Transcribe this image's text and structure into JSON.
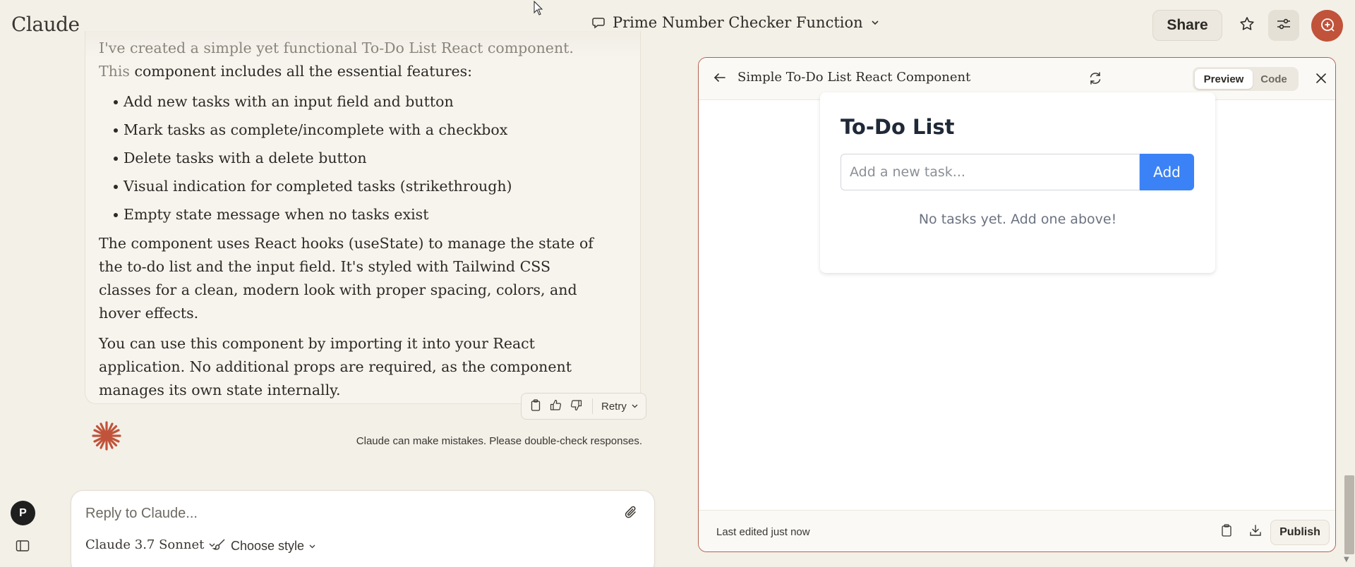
{
  "app": {
    "logo": "Claude"
  },
  "header": {
    "conversation_title": "Prime Number Checker Function",
    "share_label": "Share"
  },
  "message": {
    "intro_faded": "I've created a simple yet functional To-Do List React component. This",
    "intro_rest": "component includes all the essential features:",
    "features": [
      "Add new tasks with an input field and button",
      "Mark tasks as complete/incomplete with a checkbox",
      "Delete tasks with a delete button",
      "Visual indication for completed tasks (strikethrough)",
      "Empty state message when no tasks exist"
    ],
    "paragraph_2": "The component uses React hooks (useState) to manage the state of the to-do list and the input field. It's styled with Tailwind CSS classes for a clean, modern look with proper spacing, colors, and hover effects.",
    "paragraph_3": "You can use this component by importing it into your React application. No additional props are required, as the component manages its own state internally.",
    "retry_label": "Retry"
  },
  "disclaimer": "Claude can make mistakes. Please double-check responses.",
  "composer": {
    "placeholder": "Reply to Claude...",
    "model": "Claude 3.7 Sonnet",
    "style": "Choose style"
  },
  "user": {
    "initial": "P"
  },
  "artifact": {
    "title": "Simple To-Do List React Component",
    "tabs": {
      "preview": "Preview",
      "code": "Code",
      "active": "Preview"
    },
    "preview": {
      "heading": "To-Do List",
      "input_placeholder": "Add a new task...",
      "add_label": "Add",
      "empty_message": "No tasks yet. Add one above!"
    },
    "footer": {
      "last_edited": "Last edited just now",
      "publish_label": "Publish"
    }
  },
  "colors": {
    "accent": "#c0533a",
    "artifact_border": "#b5604c",
    "add_button": "#3b82f6",
    "background": "#f3f0e8"
  },
  "icons": [
    "chat-bubble-icon",
    "chevron-down-icon",
    "star-icon",
    "sliders-icon",
    "new-chat-icon",
    "copy-icon",
    "thumbs-up-icon",
    "thumbs-down-icon",
    "claude-spark-icon",
    "paperclip-icon",
    "style-brush-icon",
    "sidebar-toggle-icon",
    "back-arrow-icon",
    "refresh-icon",
    "close-icon",
    "download-icon"
  ]
}
